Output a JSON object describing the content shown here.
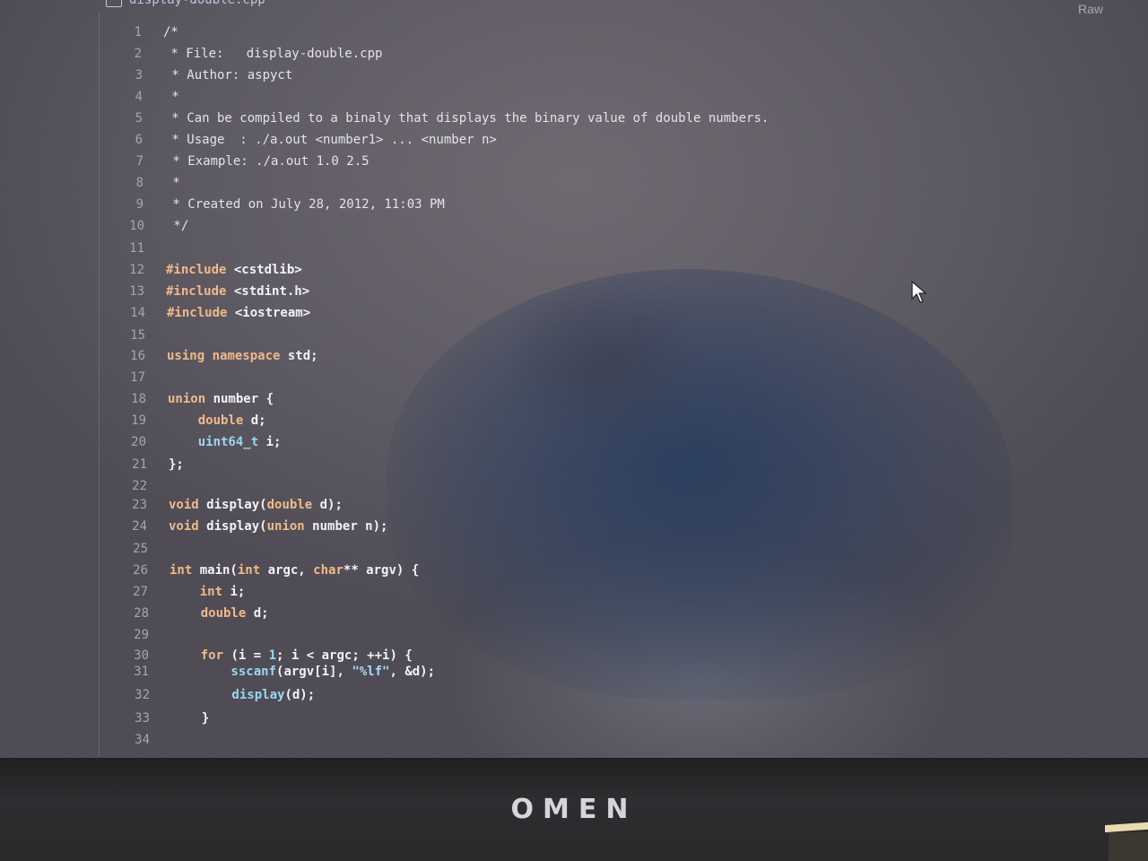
{
  "file": {
    "name": "display-double.cpp",
    "raw_label": "Raw"
  },
  "colors": {
    "screen": "#5e5a63",
    "comment": "#e4e2ea",
    "keyword": "#f0b98a",
    "type": "#9ed4f2",
    "string": "#a8d8ff",
    "line_number": "#a7a4ae",
    "bezel": "#2a292b"
  },
  "code_lines": [
    {
      "n": "1",
      "tokens": [
        {
          "t": "/*",
          "c": "c-comment"
        }
      ]
    },
    {
      "n": "2",
      "tokens": [
        {
          "t": " * File:   display-double.cpp",
          "c": "c-comment"
        }
      ]
    },
    {
      "n": "3",
      "tokens": [
        {
          "t": " * Author: aspyct",
          "c": "c-comment"
        }
      ]
    },
    {
      "n": "4",
      "tokens": [
        {
          "t": " *",
          "c": "c-comment"
        }
      ]
    },
    {
      "n": "5",
      "tokens": [
        {
          "t": " * Can be compiled to a binaly that displays the binary value of double numbers.",
          "c": "c-comment"
        }
      ]
    },
    {
      "n": "6",
      "tokens": [
        {
          "t": " * Usage  : ./a.out <number1> ... <number n>",
          "c": "c-comment"
        }
      ]
    },
    {
      "n": "7",
      "tokens": [
        {
          "t": " * Example: ./a.out 1.0 2.5",
          "c": "c-comment"
        }
      ]
    },
    {
      "n": "8",
      "tokens": [
        {
          "t": " *",
          "c": "c-comment"
        }
      ]
    },
    {
      "n": "9",
      "tokens": [
        {
          "t": " * Created on July 28, 2012, 11:03 PM",
          "c": "c-comment"
        }
      ]
    },
    {
      "n": "10",
      "tokens": [
        {
          "t": " */",
          "c": "c-comment"
        }
      ]
    },
    {
      "n": "11",
      "tokens": []
    },
    {
      "n": "12",
      "tokens": [
        {
          "t": "#include ",
          "c": "kw"
        },
        {
          "t": "<cstdlib>",
          "c": "c-code"
        }
      ]
    },
    {
      "n": "13",
      "tokens": [
        {
          "t": "#include ",
          "c": "kw"
        },
        {
          "t": "<stdint.h>",
          "c": "c-code"
        }
      ]
    },
    {
      "n": "14",
      "tokens": [
        {
          "t": "#include ",
          "c": "kw"
        },
        {
          "t": "<iostream>",
          "c": "c-code"
        }
      ]
    },
    {
      "n": "15",
      "tokens": []
    },
    {
      "n": "16",
      "tokens": [
        {
          "t": "using namespace ",
          "c": "kw"
        },
        {
          "t": "std;",
          "c": "c-code"
        }
      ]
    },
    {
      "n": "17",
      "tokens": []
    },
    {
      "n": "18",
      "tokens": [
        {
          "t": "union ",
          "c": "kw"
        },
        {
          "t": "number {",
          "c": "c-code"
        }
      ]
    },
    {
      "n": "19",
      "tokens": [
        {
          "t": "    double ",
          "c": "kw"
        },
        {
          "t": "d;",
          "c": "c-code"
        }
      ]
    },
    {
      "n": "20",
      "tokens": [
        {
          "t": "    uint64_t ",
          "c": "ty"
        },
        {
          "t": "i;",
          "c": "c-code"
        }
      ]
    },
    {
      "n": "21",
      "tokens": [
        {
          "t": "};",
          "c": "c-code"
        }
      ]
    },
    {
      "n": "22",
      "tokens": []
    },
    {
      "n": "23",
      "tokens": [
        {
          "t": "void ",
          "c": "kw"
        },
        {
          "t": "display(",
          "c": "c-code"
        },
        {
          "t": "double ",
          "c": "kw"
        },
        {
          "t": "d);",
          "c": "c-code"
        }
      ]
    },
    {
      "n": "24",
      "tokens": [
        {
          "t": "void ",
          "c": "kw"
        },
        {
          "t": "display(",
          "c": "c-code"
        },
        {
          "t": "union ",
          "c": "kw"
        },
        {
          "t": "number n);",
          "c": "c-code"
        }
      ]
    },
    {
      "n": "25",
      "tokens": []
    },
    {
      "n": "26",
      "tokens": [
        {
          "t": "int ",
          "c": "kw"
        },
        {
          "t": "main(",
          "c": "c-code"
        },
        {
          "t": "int ",
          "c": "kw"
        },
        {
          "t": "argc, ",
          "c": "c-code"
        },
        {
          "t": "char",
          "c": "kw"
        },
        {
          "t": "** argv) {",
          "c": "c-code"
        }
      ]
    },
    {
      "n": "27",
      "tokens": [
        {
          "t": "    int ",
          "c": "kw"
        },
        {
          "t": "i;",
          "c": "c-code"
        }
      ]
    },
    {
      "n": "28",
      "tokens": [
        {
          "t": "    double ",
          "c": "kw"
        },
        {
          "t": "d;",
          "c": "c-code"
        }
      ]
    },
    {
      "n": "29",
      "tokens": []
    },
    {
      "n": "30",
      "tokens": [
        {
          "t": "    for ",
          "c": "kw"
        },
        {
          "t": "(i = ",
          "c": "c-code"
        },
        {
          "t": "1",
          "c": "ty"
        },
        {
          "t": "; i < argc; ++i) {",
          "c": "c-code"
        }
      ]
    },
    {
      "n": "31",
      "tokens": [
        {
          "t": "        sscanf",
          "c": "ty"
        },
        {
          "t": "(argv[i], ",
          "c": "c-code"
        },
        {
          "t": "\"%lf\"",
          "c": "str"
        },
        {
          "t": ", &d);",
          "c": "c-code"
        }
      ]
    },
    {
      "n": "32",
      "tokens": [
        {
          "t": "        display",
          "c": "ty"
        },
        {
          "t": "(d);",
          "c": "c-code"
        }
      ]
    },
    {
      "n": "33",
      "tokens": [
        {
          "t": "    }",
          "c": "c-code"
        }
      ]
    },
    {
      "n": "34",
      "tokens": []
    }
  ],
  "laptop": {
    "brand": "OMEN"
  }
}
